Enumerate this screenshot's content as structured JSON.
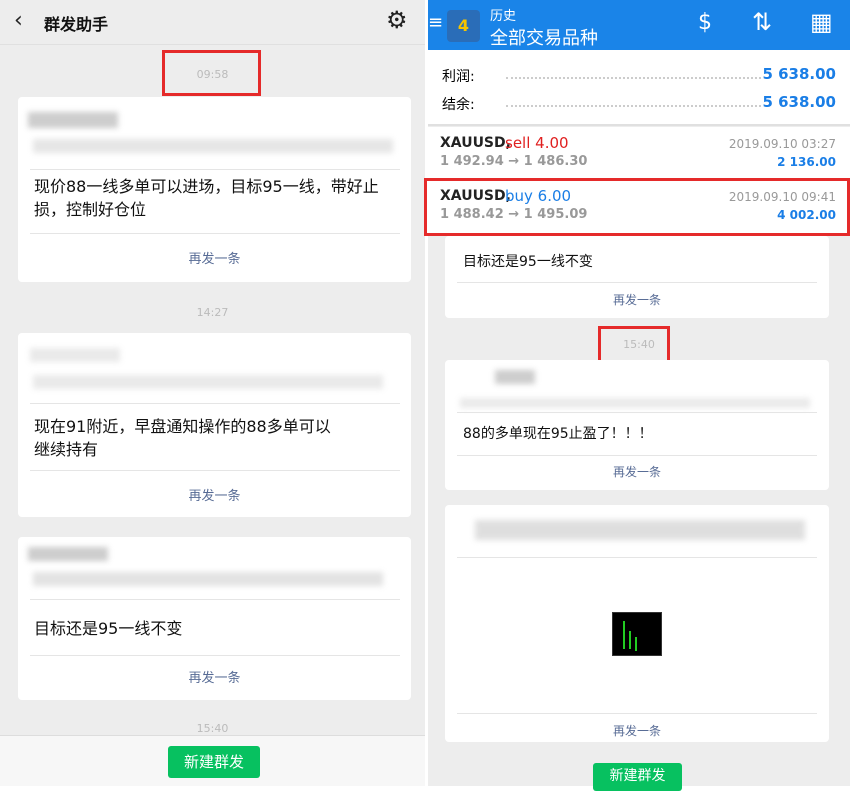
{
  "left": {
    "title": "群发助手",
    "times": [
      "09:58",
      "14:27",
      "15:40"
    ],
    "messages": [
      {
        "text": "现价88一线多单可以进场，目标95一线，带好止损，控制好仓位",
        "resend": "再发一条"
      },
      {
        "text": "现在91附近，早盘通知操作的88多单可以继续持有",
        "resend": "再发一条"
      },
      {
        "text": "目标还是95一线不变",
        "resend": "再发一条"
      }
    ],
    "new_button": "新建群发"
  },
  "right": {
    "app": {
      "subtitle": "历史",
      "title": "全部交易品种"
    },
    "summary": [
      {
        "label": "利润:",
        "value": "5 638.00"
      },
      {
        "label": "结余:",
        "value": "5 638.00"
      }
    ],
    "trades": [
      {
        "symbol": "XAUUSD,",
        "action": "sell 4.00",
        "prices": "1 492.94 → 1 486.30",
        "date": "2019.09.10 03:27",
        "profit": "2 136.00",
        "color": "#e02020"
      },
      {
        "symbol": "XAUUSD,",
        "action": "buy 6.00",
        "prices": "1 488.42 → 1 495.09",
        "date": "2019.09.10 09:41",
        "profit": "4 002.00",
        "color": "#1a7ee6"
      }
    ],
    "chat": {
      "msg1": "目标还是95一线不变",
      "resend": "再发一条",
      "time": "15:40",
      "msg2": "88的多单现在95止盈了！！！"
    },
    "new_button": "新建群发"
  }
}
